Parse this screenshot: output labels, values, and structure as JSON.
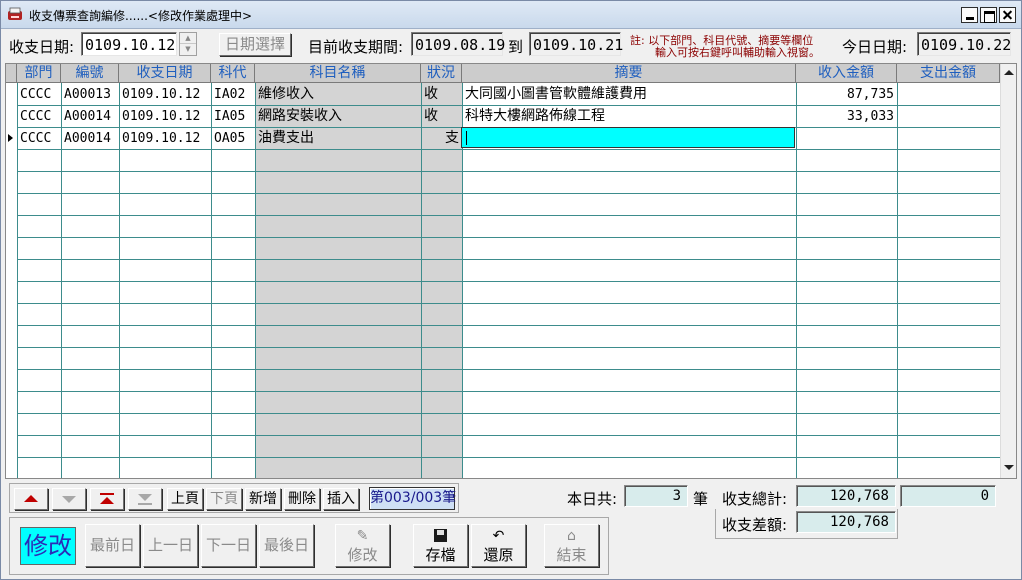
{
  "window": {
    "title": "收支傳票查詢編修......<修改作業處理中>"
  },
  "header": {
    "date_label": "收支日期:",
    "date_value": "0109.10.12",
    "date_select_button": "日期選擇",
    "period_label": "目前收支期間:",
    "period_start": "0109.08.19",
    "period_to": "到",
    "period_end": "0109.10.21",
    "note_line1": "註: 以下部門、科目代號、摘要等欄位",
    "note_line2": "輸入可按右鍵呼叫輔助輸入視窗。",
    "today_label": "今日日期:",
    "today_value": "0109.10.22"
  },
  "grid": {
    "columns": [
      "部門",
      "編號",
      "收支日期",
      "科代",
      "科目名稱",
      "狀況",
      "摘要",
      "收入金額",
      "支出金額"
    ],
    "rows": [
      {
        "dept": "CCCC",
        "no": "A00013",
        "date": "0109.10.12",
        "code": "IA02",
        "name": "維修收入",
        "status": "收",
        "memo": "大同國小圖書管軟體維護費用",
        "income": "87,735",
        "expense": ""
      },
      {
        "dept": "CCCC",
        "no": "A00014",
        "date": "0109.10.12",
        "code": "IA05",
        "name": "網路安裝收入",
        "status": "收",
        "memo": "科特大樓網路佈線工程",
        "income": "33,033",
        "expense": ""
      },
      {
        "dept": "CCCC",
        "no": "A00014",
        "date": "0109.10.12",
        "code": "OA05",
        "name": "油費支出",
        "status": "支",
        "memo": "",
        "income": "",
        "expense": ""
      }
    ],
    "current_row": 3
  },
  "nav": {
    "prev_page": "上頁",
    "next_page": "下頁",
    "add": "新增",
    "delete": "刪除",
    "insert": "插入",
    "record_counter": "第003/003筆",
    "icons": [
      "arrow-up-icon",
      "arrow-down-icon",
      "first-record-icon",
      "last-record-icon"
    ]
  },
  "summary": {
    "today_total_label": "本日共:",
    "today_count": "3",
    "count_unit": "筆",
    "total_label": "收支總計:",
    "income_total": "120,768",
    "expense_total": "0",
    "diff_label": "收支差額:",
    "diff_value": "120,768"
  },
  "actions": {
    "mode": "修改",
    "first_day": "最前日",
    "prev_day": "上一日",
    "next_day": "下一日",
    "last_day": "最後日",
    "edit": "修改",
    "save": "存檔",
    "restore": "還原",
    "exit": "結束"
  },
  "colors": {
    "active_cell": "#00ffff",
    "grid_line": "#3d8c8c",
    "header_text": "#1f5fbf",
    "note_text": "#8b0000",
    "nav_arrow": "#c00000"
  }
}
